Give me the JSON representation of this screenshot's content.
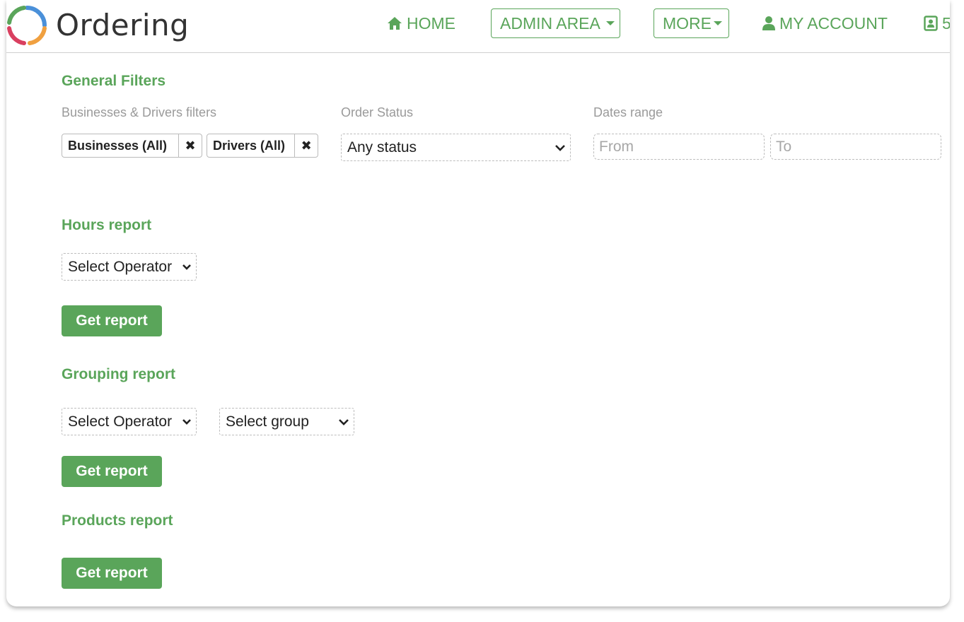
{
  "brand": {
    "name": "Ordering",
    "ring_colors": [
      "#4a90d9",
      "#f0a040",
      "#d94060",
      "#5aa55a"
    ]
  },
  "nav": {
    "home": "HOME",
    "admin_area": "ADMIN AREA",
    "more": "MORE",
    "my_account": "MY ACCOUNT",
    "extra": "5"
  },
  "general_filters": {
    "title": "General Filters",
    "businesses_label": "Businesses & Drivers filters",
    "businesses_tag": "Businesses (All)",
    "drivers_tag": "Drivers (All)",
    "remove_symbol": "✖",
    "order_status_label": "Order Status",
    "order_status_value": "Any status",
    "dates_label": "Dates range",
    "from_placeholder": "From",
    "to_placeholder": "To"
  },
  "hours_report": {
    "title": "Hours report",
    "operator_select": "Select Operator",
    "button": "Get report"
  },
  "grouping_report": {
    "title": "Grouping report",
    "operator_select": "Select Operator",
    "group_select": "Select group",
    "button": "Get report"
  },
  "products_report": {
    "title": "Products report",
    "button": "Get report"
  },
  "colors": {
    "accent": "#5aa55a",
    "border": "#bdbdbd",
    "muted_text": "#9a9a9a"
  }
}
